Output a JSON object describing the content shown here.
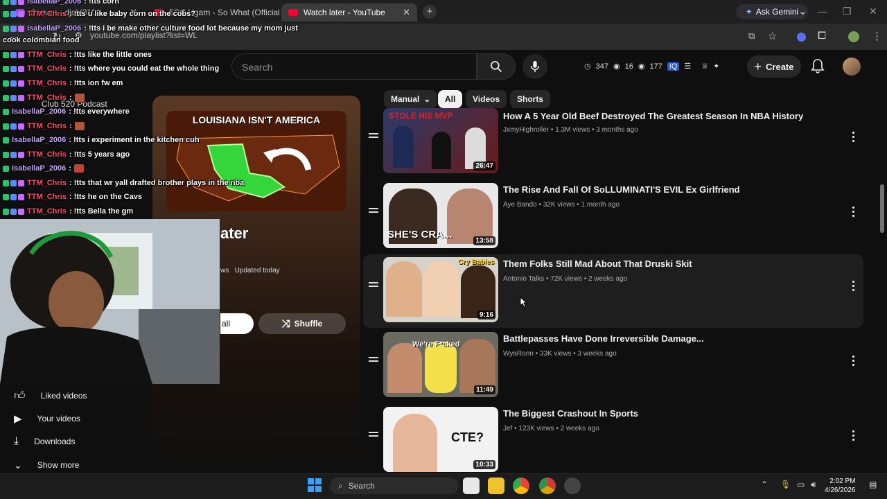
{
  "browser": {
    "tabs": [
      {
        "label": "Stream · djabi0101 · ...",
        "active": false
      },
      {
        "label": "5CC Ugam - So What (Official M...",
        "active": false
      },
      {
        "label": "Watch later - YouTube",
        "active": true
      }
    ],
    "url": "youtube.com/playlist?list=WL",
    "gemini_label": "Ask Gemini"
  },
  "header": {
    "search_placeholder": "Search",
    "stats": [
      "347",
      "16",
      "177"
    ],
    "create_label": "Create"
  },
  "chat": [
    {
      "user": "IsabellaP_2006",
      "msg": ": !tts corn"
    },
    {
      "user": "TTM_Chris",
      "msg": ": !tts u like baby corn on the cobs?"
    },
    {
      "user": "IsabellaP_2006",
      "msg": ": !tts i be make other culture food lot because my mom just"
    },
    {
      "user": "",
      "msg": "cook colombian food"
    },
    {
      "user": "TTM_Chris",
      "msg": ": !tts like the little ones"
    },
    {
      "user": "TTM_Chris",
      "msg": ": !tts where you could eat the whole thing"
    },
    {
      "user": "TTM_Chris",
      "msg": ": !tts ion fw em"
    },
    {
      "user": "TTM_Chris",
      "msg": ":"
    },
    {
      "user": "IsabellaP_2006",
      "msg": ": !tts everywhere"
    },
    {
      "user": "TTM_Chris",
      "msg": ":"
    },
    {
      "user": "IsabellaP_2006",
      "msg": ": !tts i experiment in the kitchen cuh"
    },
    {
      "user": "TTM_Chris",
      "msg": ": !tts 5 years ago"
    },
    {
      "user": "IsabellaP_2006",
      "msg": ":"
    },
    {
      "user": "TTM_Chris",
      "msg": ": !tts that wr yall drafted brother plays in the nba"
    },
    {
      "user": "TTM_Chris",
      "msg": ": !tts he on the Cavs"
    },
    {
      "user": "TTM_Chris",
      "msg": ": !tts Bella the gm"
    }
  ],
  "sidebar_bg": {
    "club": "Club 520 Podcast"
  },
  "playlist": {
    "thumb_text": "LOUISIANA ISN'T AMERICA",
    "title": "ater",
    "meta_prefix": "ws",
    "meta": "Updated today",
    "play_all": "all",
    "shuffle": "Shuffle"
  },
  "sidebar": [
    {
      "label": "Liked videos",
      "icon": "thumbs-up-icon"
    },
    {
      "label": "Your videos",
      "icon": "video-icon"
    },
    {
      "label": "Downloads",
      "icon": "download-icon"
    },
    {
      "label": "Show more",
      "icon": "chevron-down-icon"
    }
  ],
  "chips": {
    "sort": "Manual",
    "items": [
      "All",
      "Videos",
      "Shorts"
    ],
    "selected": "All"
  },
  "videos": [
    {
      "title": "How A 5 Year Old Beef Destroyed The Greatest Season In NBA History",
      "channel": "JxmyHighroller",
      "views": "1.3M views",
      "age": "3 months ago",
      "duration": "26:47",
      "thumb_text": "STOLE HIS MVP"
    },
    {
      "title": "The Rise And Fall Of SoLLUMINATI'S EVIL Ex Girlfriend",
      "channel": "Aye Bando",
      "views": "32K views",
      "age": "1 month ago",
      "duration": "13:58",
      "thumb_text": "SHE'S CRA..."
    },
    {
      "title": "Them Folks Still Mad About That Druski Skit",
      "channel": "Antonio Talks",
      "views": "72K views",
      "age": "2 weeks ago",
      "duration": "9:16",
      "thumb_text": "Cry Babies"
    },
    {
      "title": "Battlepasses Have Done Irreversible Damage...",
      "channel": "WyaRonn",
      "views": "33K views",
      "age": "3 weeks ago",
      "duration": "11:49",
      "thumb_text": "We're F*cked"
    },
    {
      "title": "The Biggest Crashout In Sports",
      "channel": "Jef",
      "views": "123K views",
      "age": "2 weeks ago",
      "duration": "10:33",
      "thumb_text": "CTE?"
    }
  ],
  "taskbar": {
    "search": "Search",
    "time": "2:02 PM",
    "date": "4/26/2026"
  },
  "colors": {
    "yt_red": "#ff0033",
    "bg": "#0f0f0f",
    "chat_user": "#ff4b6e"
  }
}
